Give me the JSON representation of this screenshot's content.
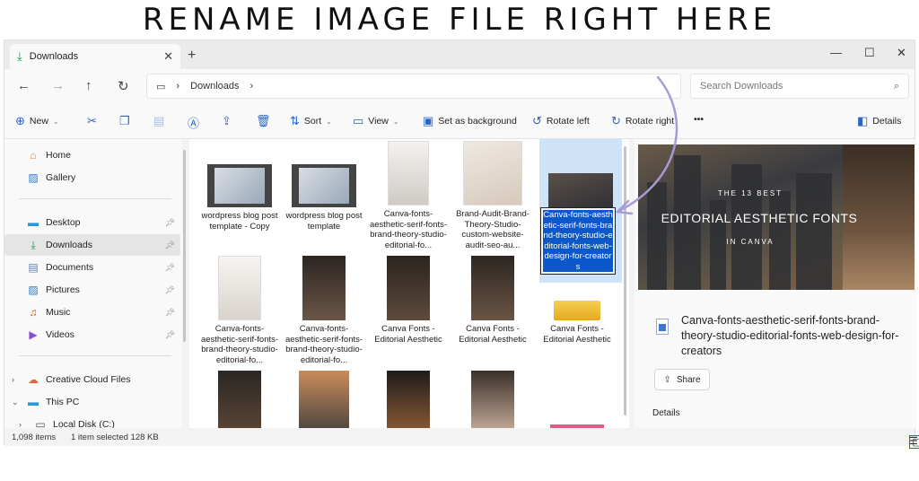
{
  "banner": {
    "title": "RENAME IMAGE FILE RIGHT HERE"
  },
  "tabbar": {
    "tab_label": "Downloads",
    "close_glyph": "✕",
    "new_tab_glyph": "+"
  },
  "window_controls": {
    "minimize": "—",
    "maximize": "☐",
    "close": "✕"
  },
  "address": {
    "path": [
      "Downloads"
    ],
    "search_placeholder": "Search Downloads"
  },
  "commands": {
    "new": "New",
    "sort": "Sort",
    "view": "View",
    "set_background": "Set as background",
    "rotate_left": "Rotate left",
    "rotate_right": "Rotate right",
    "more": "•••",
    "details": "Details"
  },
  "sidebar": {
    "items": [
      {
        "label": "Home",
        "icon": "home-icon"
      },
      {
        "label": "Gallery",
        "icon": "gallery-icon"
      },
      {
        "label": "Desktop",
        "icon": "desktop-icon"
      },
      {
        "label": "Downloads",
        "icon": "download-icon"
      },
      {
        "label": "Documents",
        "icon": "documents-icon"
      },
      {
        "label": "Pictures",
        "icon": "pictures-icon"
      },
      {
        "label": "Music",
        "icon": "music-icon"
      },
      {
        "label": "Videos",
        "icon": "videos-icon"
      },
      {
        "label": "Creative Cloud Files",
        "icon": "creative-cloud-icon"
      },
      {
        "label": "This PC",
        "icon": "pc-icon"
      },
      {
        "label": "Local Disk (C:)",
        "icon": "disk-icon"
      }
    ]
  },
  "files": [
    {
      "name": "wordpress blog post template - Copy"
    },
    {
      "name": "wordpress blog post template"
    },
    {
      "name": "Canva-fonts-aesthetic-serif-fonts-brand-theory-studio-editorial-fo..."
    },
    {
      "name": "Brand-Audit-Brand-Theory-Studio-custom-website-audit-seo-au..."
    },
    {
      "name": "Canva-fonts-aesthetic-serif-fonts-brand-theory-studio-editorial-fonts-web-design-for-creators",
      "selected": true
    },
    {
      "name": "Canva-fonts-aesthetic-serif-fonts-brand-theory-studio-editorial-fo..."
    },
    {
      "name": "Canva-fonts-aesthetic-serif-fonts-brand-theory-studio-editorial-fo..."
    },
    {
      "name": "Canva Fonts - Editorial Aesthetic"
    },
    {
      "name": "Canva Fonts - Editorial Aesthetic"
    },
    {
      "name": "Canva Fonts - Editorial Aesthetic"
    }
  ],
  "details_pane": {
    "preview_line1": "THE 13 BEST",
    "preview_line2": "EDITORIAL AESTHETIC FONTS",
    "preview_line3": "IN CANVA",
    "file_name": "Canva-fonts-aesthetic-serif-fonts-brand-theory-studio-editorial-fonts-web-design-for-creators",
    "share": "Share",
    "details_label": "Details"
  },
  "status": {
    "items": "1,098 items",
    "selected": "1 item selected  128 KB"
  },
  "colors": {
    "accent": "#0a58c9",
    "arrow": "#a79bd6",
    "selection": "#cfe3f8"
  }
}
